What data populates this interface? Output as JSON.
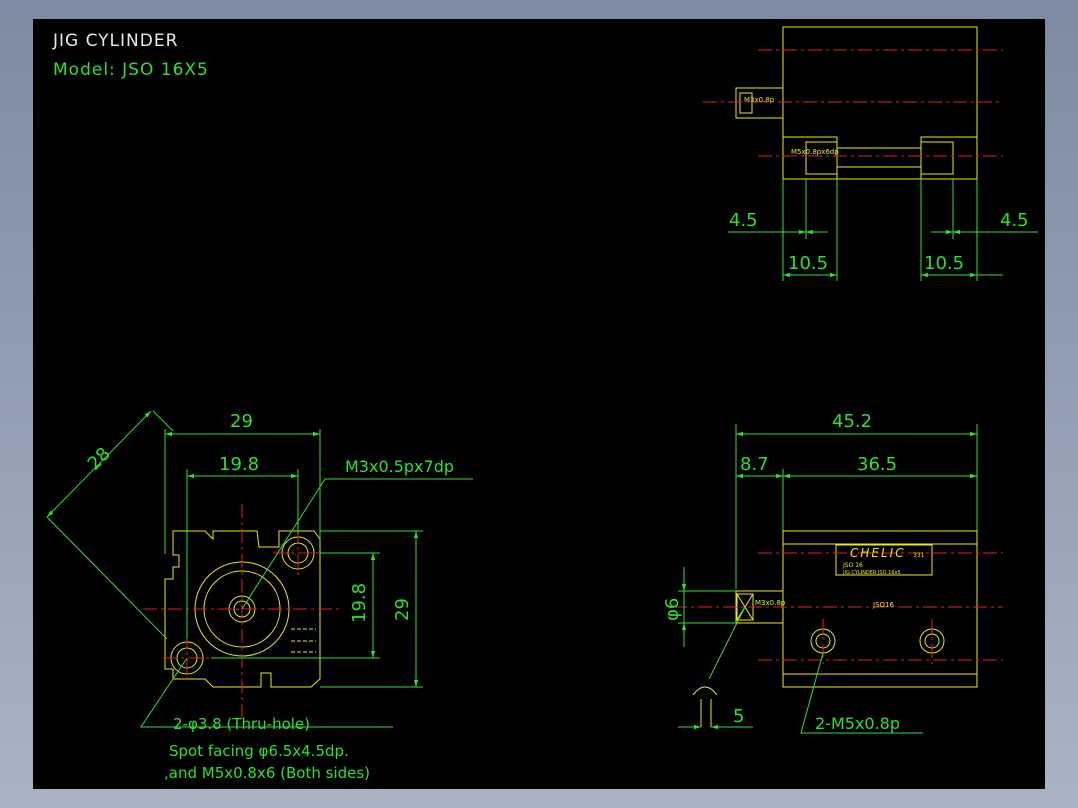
{
  "header": {
    "title": "JIG CYLINDER",
    "model": "Model: JSO 16X5"
  },
  "colors": {
    "background": "#000000",
    "outline": "#e8e820",
    "dimension": "#2fe02f",
    "centerline": "#e02020",
    "title_text": "#e8e8e8"
  },
  "top_view": {
    "port_label": "M3x0.8p",
    "thread_label": "M5x0.8px6dp",
    "dims": {
      "left_small": "4.5",
      "right_small": "4.5",
      "left_large": "10.5",
      "right_large": "10.5"
    }
  },
  "front_view": {
    "width": "29",
    "hole_pitch_h": "19.8",
    "hole_pitch_v": "19.8",
    "height": "29",
    "diagonal": "28",
    "tap_callout": "M3x0.5px7dp",
    "hole_callout": "2-φ3.8 (Thru-hole)",
    "spot_facing": "Spot facing φ6.5x4.5dp.",
    "both_sides": ",and M5x0.8x6 (Both sides)"
  },
  "side_view": {
    "overall": "45.2",
    "rod_length": "8.7",
    "body_length": "36.5",
    "rod_diameter": "φ6",
    "rod_end": "5",
    "port_callout": "2-M5x0.8p",
    "rod_thread": "M3x0.8p",
    "brand": "CHELIC",
    "brand_code": "331",
    "label_line1": "JSO 16",
    "label_line2": "JIG CYLINDER JSO 16x5",
    "body_mark": "JSO16"
  }
}
